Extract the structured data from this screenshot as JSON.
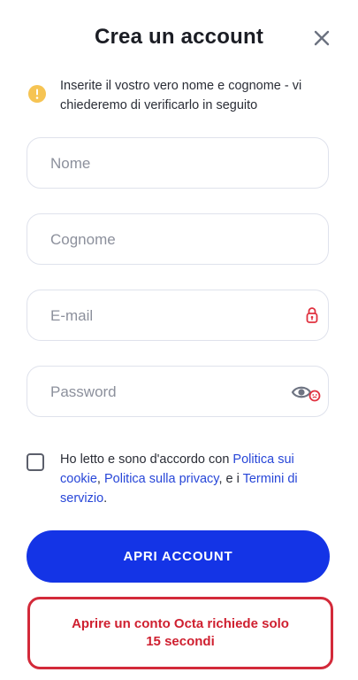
{
  "header": {
    "title": "Crea un account"
  },
  "notice": {
    "text": "Inserite il vostro vero nome e cognome - vi chiederemo di verificarlo in seguito"
  },
  "form": {
    "first_name": {
      "placeholder": "Nome",
      "value": ""
    },
    "last_name": {
      "placeholder": "Cognome",
      "value": ""
    },
    "email": {
      "placeholder": "E-mail",
      "value": ""
    },
    "password": {
      "placeholder": "Password",
      "value": ""
    }
  },
  "consent": {
    "prefix": "Ho letto e sono d'accordo con ",
    "cookie_link": "Politica sui cookie",
    "sep1": ", ",
    "privacy_link": "Politica sulla privacy",
    "sep2": ", e i ",
    "terms_link": "Termini di servizio",
    "suffix": "."
  },
  "cta": {
    "label": "APRI ACCOUNT"
  },
  "promo": {
    "line1": "Aprire un conto Octa richiede solo",
    "line2": "15 secondi"
  },
  "colors": {
    "primary": "#1434e6",
    "link": "#2746d8",
    "alert_red": "#d32a3a",
    "info_yellow": "#f6c453"
  },
  "icons": {
    "close": "close-icon",
    "info": "info-icon",
    "lock": "lock-icon",
    "eye": "eye-icon"
  }
}
